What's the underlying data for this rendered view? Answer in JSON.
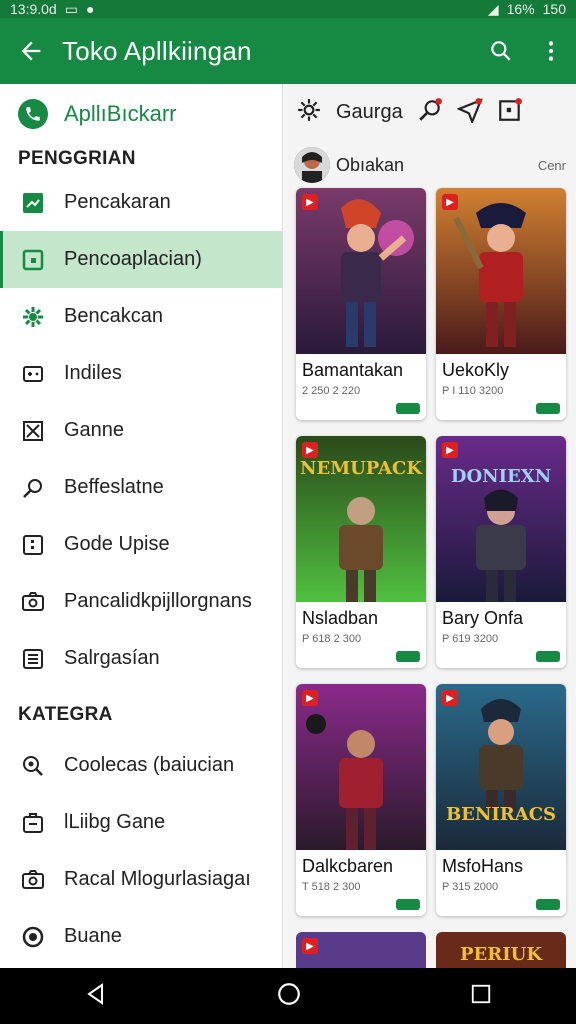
{
  "status": {
    "time": "13:9.0d",
    "battery": "16%",
    "right_num": "150"
  },
  "app_bar": {
    "title": "Toko Apllkiingan",
    "back_icon": "back-arrow-icon",
    "search_icon": "search-icon",
    "more_icon": "more-vert-icon"
  },
  "drawer": {
    "header_label": "ApllıBıckarr",
    "section1": "PENGGRIAN",
    "items": [
      {
        "label": "Pencakaran",
        "icon": "trending-icon"
      },
      {
        "label": "Pencoaplacian)",
        "icon": "square-dot-icon",
        "active": true
      },
      {
        "label": "Bencakcan",
        "icon": "gear-icon"
      },
      {
        "label": "Indiles",
        "icon": "gamepad-icon"
      },
      {
        "label": "Ganne",
        "icon": "box-x-icon"
      },
      {
        "label": "Beffeslatne",
        "icon": "search-icon"
      },
      {
        "label": "Gode Upise",
        "icon": "frame-icon"
      },
      {
        "label": "Pancalidkpijllorgnans",
        "icon": "camera-icon"
      },
      {
        "label": "Salrgasían",
        "icon": "list-icon"
      }
    ],
    "section2": "KATEGRA",
    "items2": [
      {
        "label": "Coolecas (baiucian",
        "icon": "zoom-icon"
      },
      {
        "label": "lLiibg Gane",
        "icon": "briefcase-icon"
      },
      {
        "label": "Racal Mlogurlasiagaı",
        "icon": "camera-icon"
      },
      {
        "label": "Buane",
        "icon": "radio-icon"
      }
    ]
  },
  "main": {
    "tab_label": "Gaurga",
    "user_name": "Obıakan",
    "user_tag": "Cenr",
    "cards": [
      {
        "name": "Bamantakan",
        "meta": "2 250 2 220",
        "hue": "#5a2a4a",
        "accent": "#d04428"
      },
      {
        "name": "UekoKly",
        "meta": "P I 110 3200",
        "hue": "#7a2a1a",
        "accent": "#f0a030"
      },
      {
        "name": "Nsladban",
        "meta": "P 618 2 300",
        "hue": "#2a4a1a",
        "accent": "#e0c040",
        "banner": "NEMUPACK"
      },
      {
        "name": "Bary Onfa",
        "meta": "P 619 3200",
        "hue": "#3a1a5a",
        "accent": "#c040c0",
        "banner": "DONIEXN"
      },
      {
        "name": "Dalkcbaren",
        "meta": "T 518 2 300",
        "hue": "#4a1a4a",
        "accent": "#a02030"
      },
      {
        "name": "MsfoHans",
        "meta": "P 315 2000",
        "hue": "#1a3a5a",
        "accent": "#e0a020",
        "banner": "BENIRACS"
      }
    ],
    "partial": [
      {
        "hue": "#5a3a8a",
        "banner": ""
      },
      {
        "hue": "#6a2a1a",
        "banner": "PERIUK"
      }
    ]
  },
  "nav": {
    "back": "nav-back-icon",
    "home": "nav-home-icon",
    "recents": "nav-recents-icon"
  }
}
